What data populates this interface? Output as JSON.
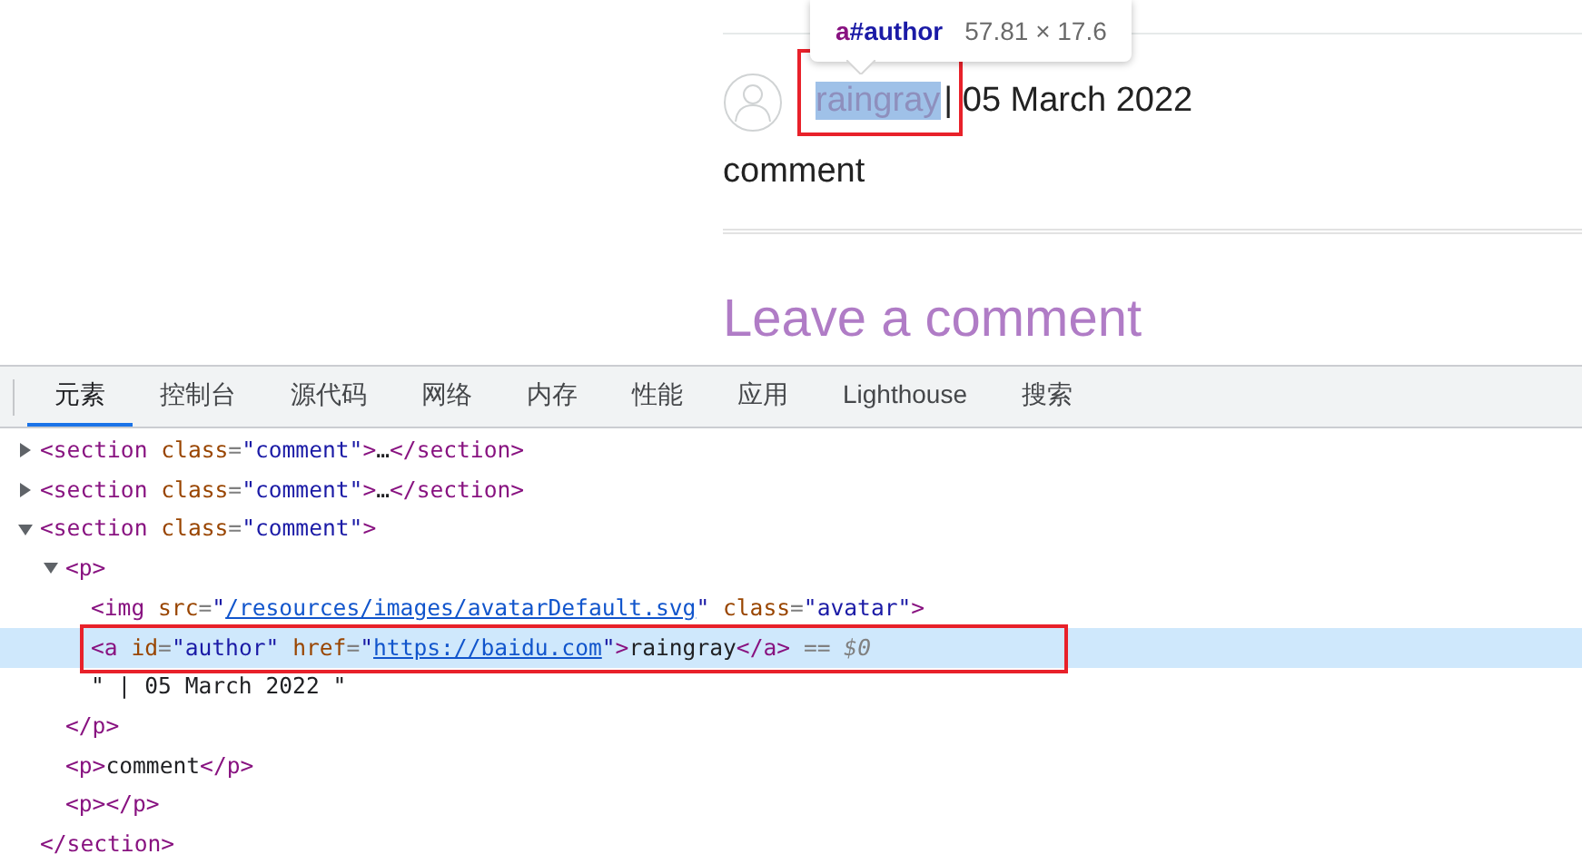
{
  "page": {
    "author": {
      "text": "raingray",
      "highlighted": true,
      "outlined": true
    },
    "date": "| 05 March 2022",
    "comment": "comment",
    "heading": "Leave a comment"
  },
  "tooltip": {
    "tag": "a",
    "id": "#author",
    "size": "57.81 × 17.6"
  },
  "devtools": {
    "tabs": [
      {
        "label": "元素",
        "selected": true
      },
      {
        "label": "控制台",
        "selected": false
      },
      {
        "label": "源代码",
        "selected": false
      },
      {
        "label": "网络",
        "selected": false
      },
      {
        "label": "内存",
        "selected": false
      },
      {
        "label": "性能",
        "selected": false
      },
      {
        "label": "应用",
        "selected": false
      },
      {
        "label": "Lighthouse",
        "selected": false
      },
      {
        "label": "搜索",
        "selected": false
      }
    ],
    "dom": [
      {
        "expanded": false,
        "selected": false,
        "outlined": false,
        "tokens": [
          {
            "kind": "tag",
            "text": "<section"
          },
          {
            "kind": "attr",
            "text": " class"
          },
          {
            "kind": "punct",
            "text": "="
          },
          {
            "kind": "value",
            "text": "\"comment\""
          },
          {
            "kind": "tag",
            "text": ">"
          },
          {
            "kind": "text",
            "text": "…"
          },
          {
            "kind": "tag",
            "text": "</section>"
          }
        ]
      },
      {
        "expanded": false,
        "selected": false,
        "outlined": false,
        "tokens": [
          {
            "kind": "tag",
            "text": "<section"
          },
          {
            "kind": "attr",
            "text": " class"
          },
          {
            "kind": "punct",
            "text": "="
          },
          {
            "kind": "value",
            "text": "\"comment\""
          },
          {
            "kind": "tag",
            "text": ">"
          },
          {
            "kind": "text",
            "text": "…"
          },
          {
            "kind": "tag",
            "text": "</section>"
          }
        ]
      },
      {
        "expanded": true,
        "selected": false,
        "outlined": false,
        "tokens": [
          {
            "kind": "tag",
            "text": "<section"
          },
          {
            "kind": "attr",
            "text": " class"
          },
          {
            "kind": "punct",
            "text": "="
          },
          {
            "kind": "value",
            "text": "\"comment\""
          },
          {
            "kind": "tag",
            "text": ">"
          }
        ],
        "closing": "</section>",
        "children": [
          {
            "expanded": true,
            "selected": false,
            "outlined": false,
            "tokens": [
              {
                "kind": "tag",
                "text": "<p>"
              }
            ],
            "closing": "</p>",
            "children": [
              {
                "selected": false,
                "outlined": false,
                "tokens": [
                  {
                    "kind": "tag",
                    "text": "<img"
                  },
                  {
                    "kind": "attr",
                    "text": " src"
                  },
                  {
                    "kind": "punct",
                    "text": "="
                  },
                  {
                    "kind": "value",
                    "text": "\""
                  },
                  {
                    "kind": "link",
                    "text": "/resources/images/avatarDefault.svg"
                  },
                  {
                    "kind": "value",
                    "text": "\""
                  },
                  {
                    "kind": "attr",
                    "text": " class"
                  },
                  {
                    "kind": "punct",
                    "text": "="
                  },
                  {
                    "kind": "value",
                    "text": "\"avatar\""
                  },
                  {
                    "kind": "tag",
                    "text": ">"
                  }
                ]
              },
              {
                "selected": true,
                "outlined": true,
                "tokens": [
                  {
                    "kind": "tag",
                    "text": "<a"
                  },
                  {
                    "kind": "attr",
                    "text": " id"
                  },
                  {
                    "kind": "punct",
                    "text": "="
                  },
                  {
                    "kind": "value",
                    "text": "\"author\""
                  },
                  {
                    "kind": "attr",
                    "text": " href"
                  },
                  {
                    "kind": "punct",
                    "text": "="
                  },
                  {
                    "kind": "value",
                    "text": "\""
                  },
                  {
                    "kind": "link",
                    "text": "https://baidu.com"
                  },
                  {
                    "kind": "value",
                    "text": "\""
                  },
                  {
                    "kind": "tag",
                    "text": ">"
                  },
                  {
                    "kind": "text",
                    "text": "raingray"
                  },
                  {
                    "kind": "tag",
                    "text": "</a>"
                  },
                  {
                    "kind": "punct",
                    "text": " == "
                  },
                  {
                    "kind": "var",
                    "text": "$0"
                  }
                ]
              },
              {
                "selected": false,
                "outlined": false,
                "tokens": [
                  {
                    "kind": "text",
                    "text": "\" | 05 March 2022 \""
                  }
                ]
              }
            ]
          },
          {
            "selected": false,
            "outlined": false,
            "tokens": [
              {
                "kind": "tag",
                "text": "<p>"
              },
              {
                "kind": "text",
                "text": "comment"
              },
              {
                "kind": "tag",
                "text": "</p>"
              }
            ]
          },
          {
            "selected": false,
            "outlined": false,
            "tokens": [
              {
                "kind": "tag",
                "text": "<p></p>"
              }
            ]
          }
        ]
      }
    ]
  }
}
